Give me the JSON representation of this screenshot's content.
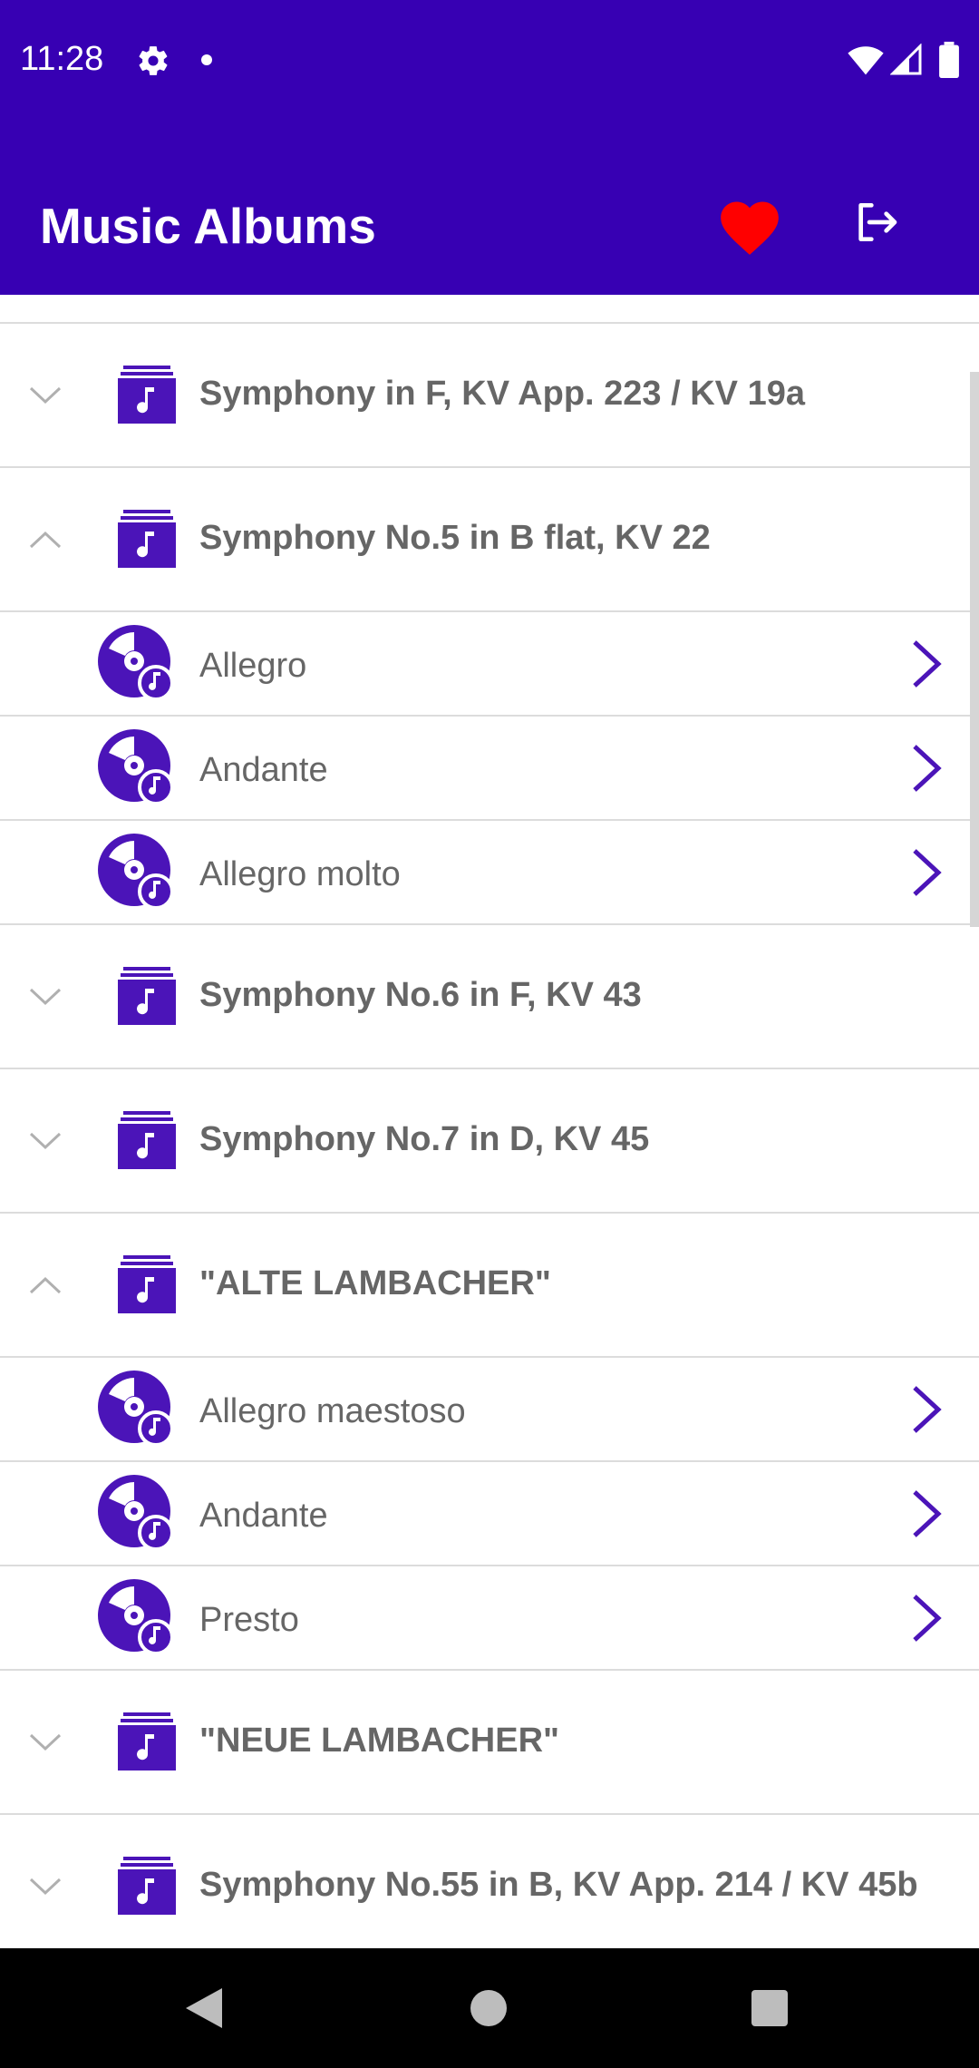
{
  "status_bar": {
    "time": "11:28"
  },
  "app_bar": {
    "title": "Music Albums"
  },
  "list": {
    "groups": [
      {
        "title": "Symphony in F, KV App. 223 / KV 19a",
        "expanded": false
      },
      {
        "title": "Symphony No.5 in B flat, KV 22",
        "expanded": true,
        "tracks": [
          "Allegro",
          "Andante",
          "Allegro molto"
        ]
      },
      {
        "title": "Symphony No.6 in F, KV 43",
        "expanded": false
      },
      {
        "title": "Symphony No.7 in D, KV 45",
        "expanded": false
      },
      {
        "title": "\"ALTE LAMBACHER\"",
        "expanded": true,
        "tracks": [
          "Allegro maestoso",
          "Andante",
          "Presto"
        ]
      },
      {
        "title": "\"NEUE LAMBACHER\"",
        "expanded": false
      },
      {
        "title": "Symphony No.55 in B, KV App. 214 / KV 45b",
        "expanded": false
      }
    ]
  },
  "colors": {
    "primary": "#3700B3",
    "accent_purple": "#4B14B8",
    "heart": "#FF0000",
    "text_gray": "#666666"
  }
}
